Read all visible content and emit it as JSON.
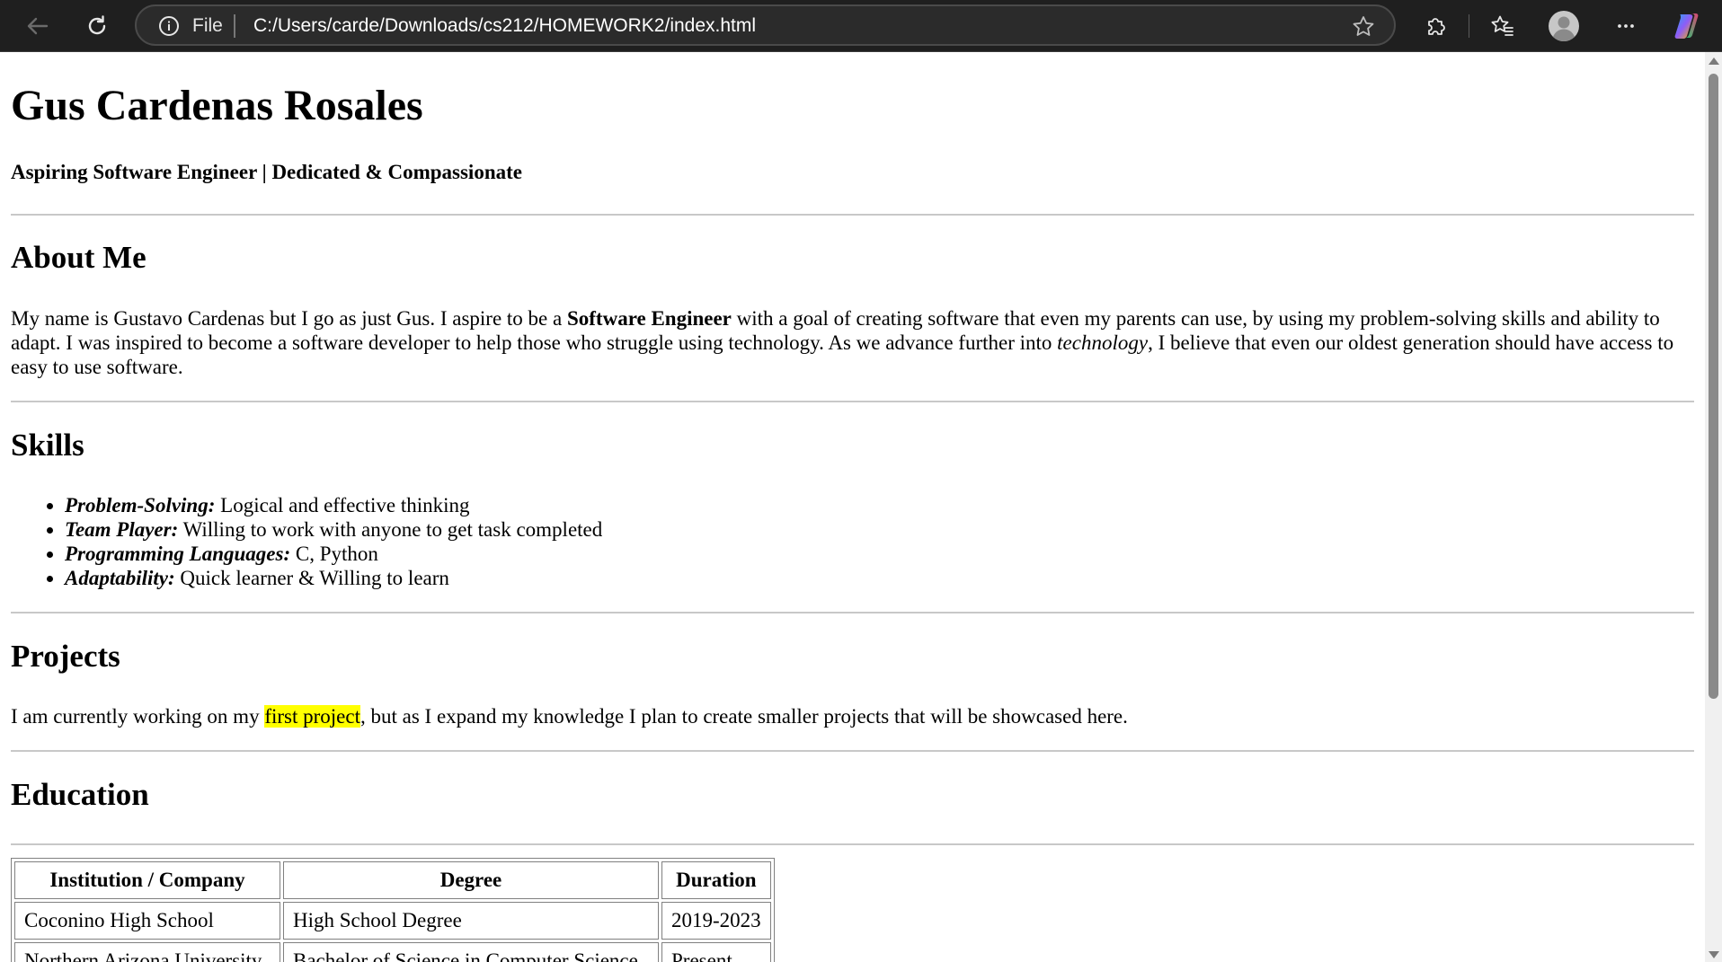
{
  "browser": {
    "address": {
      "scheme_label": "File",
      "url": "C:/Users/carde/Downloads/cs212/HOMEWORK2/index.html"
    },
    "icons": {
      "back": "arrow-left-icon",
      "reload": "reload-icon",
      "info": "info-icon",
      "favorite": "star-icon",
      "extensions": "puzzle-icon",
      "favorites": "favorites-icon",
      "profile": "avatar",
      "more": "more-icon",
      "copilot": "copilot-icon"
    }
  },
  "page": {
    "name": "Gus Cardenas Rosales",
    "tagline": "Aspiring Software Engineer | Dedicated & Compassionate",
    "about": {
      "heading": "About Me",
      "text_1": "My name is Gustavo Cardenas but I go as just Gus. I aspire to be a ",
      "bold": "Software Engineer",
      "text_2": " with a goal of creating software that even my parents can use, by using my problem-solving skills and ability to adapt. I was inspired to become a software developer to help those who struggle using technology. As we advance further into ",
      "italic": "technology",
      "text_3": ", I believe that even our oldest generation should have access to easy to use software."
    },
    "skills": {
      "heading": "Skills",
      "items": [
        {
          "label": "Problem-Solving:",
          "desc": " Logical and effective thinking"
        },
        {
          "label": "Team Player:",
          "desc": " Willing to work with anyone to get task completed"
        },
        {
          "label": "Programming Languages:",
          "desc": " C, Python"
        },
        {
          "label": "Adaptability:",
          "desc": " Quick learner & Willing to learn"
        }
      ]
    },
    "projects": {
      "heading": "Projects",
      "text_1": "I am currently working on my ",
      "highlight": "first project",
      "text_2": ", but as I expand my knowledge I plan to create smaller projects that will be showcased here."
    },
    "education": {
      "heading": "Education",
      "columns": [
        "Institution / Company",
        "Degree",
        "Duration"
      ],
      "rows": [
        [
          "Coconino High School",
          "High School Degree",
          "2019-2023"
        ],
        [
          "Northern Arizona University",
          "Bachelor of Science in Computer Science",
          "Present"
        ]
      ]
    }
  },
  "colors": {
    "toolbar_bg": "#1f1f1f",
    "highlight": "#ffff00",
    "rule": "#c8c8c8"
  }
}
